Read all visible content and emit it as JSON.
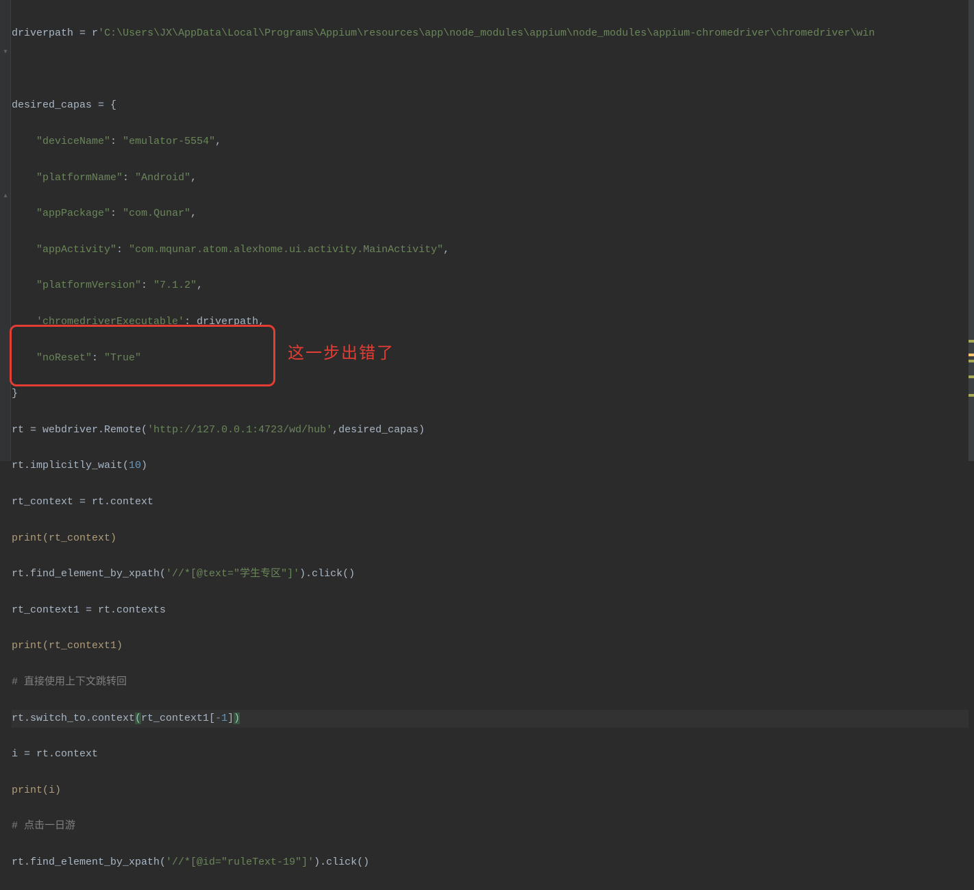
{
  "code": {
    "l1": {
      "varA": "driverpath ",
      "op": "= ",
      "prefix": "r",
      "str": "'C:\\Users\\JX\\AppData\\Local\\Programs\\Appium\\resources\\app\\node_modules\\appium\\node_modules\\appium-chromedriver\\chromedriver\\win"
    },
    "l3": {
      "var": "desired_capas ",
      "op": "= ",
      "br": "{"
    },
    "l4": {
      "indent": "    ",
      "key": "\"deviceName\"",
      "col": ": ",
      "val": "\"emulator-5554\"",
      "c": ","
    },
    "l5": {
      "indent": "    ",
      "key": "\"platformName\"",
      "col": ": ",
      "val": "\"Android\"",
      "c": ","
    },
    "l6": {
      "indent": "    ",
      "key": "\"appPackage\"",
      "col": ": ",
      "val": "\"com.Qunar\"",
      "c": ","
    },
    "l7": {
      "indent": "    ",
      "key": "\"appActivity\"",
      "col": ": ",
      "val": "\"com.mqunar.atom.alexhome.ui.activity.MainActivity\"",
      "c": ","
    },
    "l8": {
      "indent": "    ",
      "key": "\"platformVersion\"",
      "col": ": ",
      "val": "\"7.1.2\"",
      "c": ","
    },
    "l9": {
      "indent": "    ",
      "key": "'chromedriverExecutable'",
      "col": ": ",
      "var": "driverpath",
      "c": ","
    },
    "l10": {
      "indent": "    ",
      "key": "\"noReset\"",
      "col": ": ",
      "val": "\"True\""
    },
    "l11": {
      "text": "}"
    },
    "l12": {
      "a": "rt ",
      "op": "= ",
      "b": "webdriver.Remote(",
      "str": "'http://127.0.0.1:4723/wd/hub'",
      "c": ",",
      "d": "desired_capas)"
    },
    "l13": {
      "a": "rt.implicitly_wait(",
      "num": "10",
      "b": ")"
    },
    "l14": {
      "a": "rt_context ",
      "op": "= ",
      "b": "rt.context"
    },
    "l15": {
      "a": "print(rt_context)"
    },
    "l16": {
      "a": "rt.find_element_by_xpath(",
      "str": "'//*[@text=\"学生专区\"]'",
      "b": ").click()"
    },
    "l17": {
      "a": "rt_context1 ",
      "op": "= ",
      "b": "rt.contexts"
    },
    "l18": {
      "a": "print(rt_context1)"
    },
    "l19": {
      "cmt": "# 直接使用上下文跳转回"
    },
    "l20": {
      "a": "rt.switch_to.context",
      "open": "(",
      "b": "rt_context1[",
      "num": "-1",
      "c": "]",
      "close": ")"
    },
    "l21": {
      "a": "i ",
      "op": "= ",
      "b": "rt.context"
    },
    "l22": {
      "a": "print(i)"
    },
    "l23": {
      "cmt": "# 点击一日游"
    },
    "l24": {
      "a": "rt.find_element_by_xpath(",
      "str": "'//*[@id=\"ruleText-19\"]'",
      "b": ").click()"
    }
  },
  "annotation": {
    "label": "这一步出错了"
  },
  "colors": {
    "bg": "#2b2b2b",
    "text": "#a9b7c6",
    "string": "#6a8759",
    "number": "#6897bb",
    "comment": "#808080",
    "annotation": "#e43d33"
  }
}
